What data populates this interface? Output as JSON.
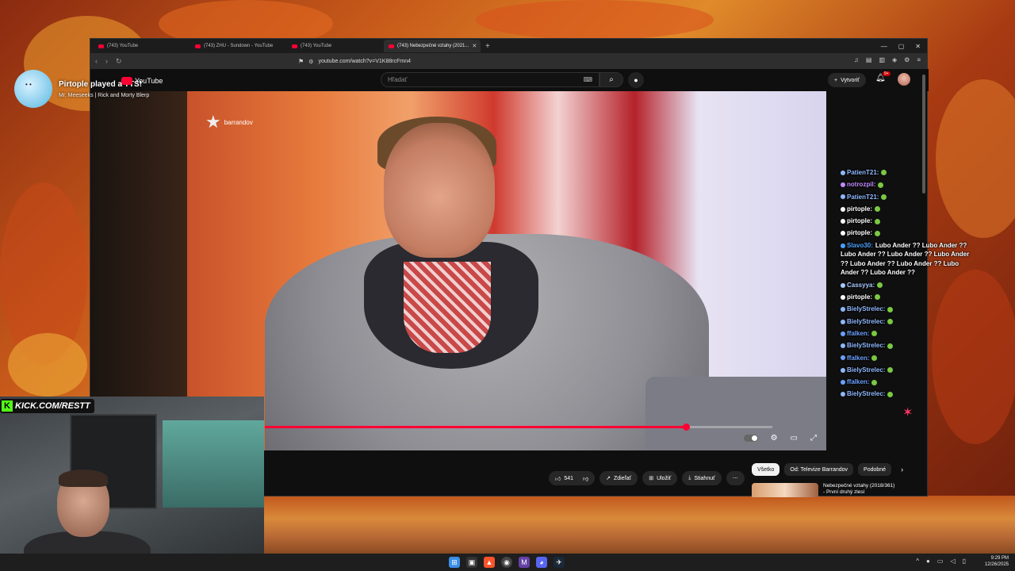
{
  "browser": {
    "tabs": [
      {
        "label": "(743) YouTube",
        "active": false
      },
      {
        "label": "(743) ZHU - Sundown - YouTube",
        "active": false
      },
      {
        "label": "(743) YouTube",
        "active": false
      },
      {
        "label": "(743) Nebezpečné vztahy (2021...",
        "active": true
      }
    ],
    "url": "youtube.com/watch?v=V1K88rcFmn4"
  },
  "youtube": {
    "search_placeholder": "Hľadať",
    "create_label": "Vytvoriť",
    "notifications_badge": "9+",
    "brand_watermark": "barrandov",
    "actions": {
      "likes": "541",
      "share": "Zdieľať",
      "save": "Uložiť",
      "download": "Stiahnuť",
      "more": "⋯"
    },
    "chips": [
      "Všetko",
      "Od: Televize Barrandov",
      "Podobné"
    ],
    "recommended": {
      "title": "Nebezpečné vztahy (2018/361)",
      "subtitle": "- První druhý zlesí"
    },
    "progress_fraction": 0.83
  },
  "overlay": {
    "title": "Pirtople played a TTS!",
    "subtitle": "Mr. Meeseeks | Rick and Morty Blerp",
    "youtube_logo": "YouTube",
    "kick_label": "KICK.COM/RESTT"
  },
  "chat": [
    {
      "user": "PatienT21:",
      "color": "#8fb8ff"
    },
    {
      "user": "notrozpil:",
      "color": "#c08cff"
    },
    {
      "user": "PatienT21:",
      "color": "#8fb8ff"
    },
    {
      "user": "pirtople:",
      "color": "#ffffff"
    },
    {
      "user": "pirtople:",
      "color": "#ffffff"
    },
    {
      "user": "pirtople:",
      "color": "#ffffff"
    },
    {
      "user": "Slavo30:",
      "color": "#4aa0ff",
      "message": "Lubo Ander ?? Lubo Ander ?? Lubo Ander ?? Lubo Ander ?? Lubo Ander ?? Lubo Ander ?? Lubo Ander ?? Lubo Ander ?? Lubo Ander ??"
    },
    {
      "user": "Cassyya:",
      "color": "#a8c8ff"
    },
    {
      "user": "pirtople:",
      "color": "#ffffff"
    },
    {
      "user": "BielyStrelec:",
      "color": "#8fb8ff"
    },
    {
      "user": "BielyStrelec:",
      "color": "#8fb8ff"
    },
    {
      "user": "ffalken:",
      "color": "#6aa0ff"
    },
    {
      "user": "BielyStrelec:",
      "color": "#8fb8ff"
    },
    {
      "user": "ffalken:",
      "color": "#6aa0ff"
    },
    {
      "user": "BielyStrelec:",
      "color": "#8fb8ff"
    },
    {
      "user": "ffalken:",
      "color": "#6aa0ff"
    },
    {
      "user": "BielyStrelec:",
      "color": "#8fb8ff"
    }
  ],
  "taskbar": {
    "time": "9:29 PM",
    "date": "12/26/2025"
  }
}
